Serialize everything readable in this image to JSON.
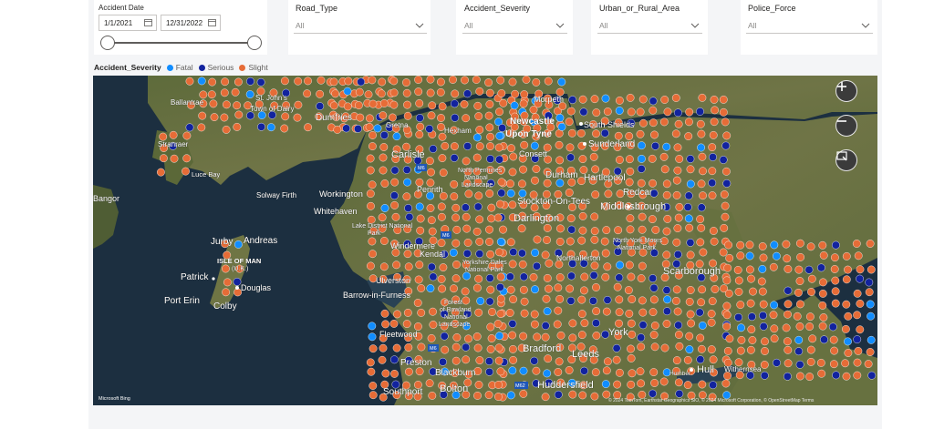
{
  "slicers": {
    "date": {
      "title": "Accident Date",
      "start": "1/1/2021",
      "end": "12/31/2022"
    },
    "dropdowns": [
      {
        "title": "Road_Type",
        "value": "All"
      },
      {
        "title": "Accident_Severity",
        "value": "All"
      },
      {
        "title": "Urban_or_Rural_Area",
        "value": "All"
      },
      {
        "title": "Police_Force",
        "value": "All"
      }
    ]
  },
  "legend": {
    "title": "Accident_Severity",
    "items": [
      {
        "label": "Fatal",
        "color": "#118dff"
      },
      {
        "label": "Serious",
        "color": "#12239e"
      },
      {
        "label": "Slight",
        "color": "#e66c37"
      }
    ]
  },
  "map": {
    "labels": {
      "ballantrae": "Ballantrae",
      "st_johns": "St. John's",
      "town_of_dalry": "Town of Dalry",
      "dumfries": "Dumfries",
      "gretna": "Gretna",
      "newcastle": "Newcastle",
      "upon_tyne": "Upon Tyne",
      "morpeth": "Morpeth",
      "south_shields": "South Shields",
      "sunderland": "Sunderland",
      "stranraer": "Stranraer",
      "carlisle": "Carlisle",
      "hexham": "Hexham",
      "consett": "Consett",
      "luce_bay": "Luce Bay",
      "north_pennines": "North Pennines",
      "national": "National",
      "landscape": "Landscape",
      "durham": "Durham",
      "hartlepool": "Hartlepool",
      "redcar": "Redcar",
      "bangor": "Bangor",
      "solway_firth": "Solway Firth",
      "workington": "Workington",
      "penrith": "Penrith",
      "stockton": "Stockton-On-Tees",
      "middlesbrough": "Middlesbrough",
      "whitehaven": "Whitehaven",
      "darlington": "Darlington",
      "lake_district": "Lake District National",
      "park": "Park",
      "jurby": "Jurby",
      "andreas": "Andreas",
      "windermere": "Windermere",
      "kendal": "Kendal",
      "north_york_moors": "North York Moors",
      "national_park": "National Park",
      "isle_of_man": "ISLE OF MAN",
      "uk": "(U.K.)",
      "yorkshire_dales": "Yorkshire Dales",
      "yorkshire_np": "National Park",
      "northallerton": "Northallerton",
      "scarborough": "Scarborough",
      "patrick": "Patrick",
      "ulverston": "Ulverston",
      "douglas": "Douglas",
      "barrow": "Barrow-in-Furness",
      "port_erin": "Port Erin",
      "colby": "Colby",
      "forest": "Forest",
      "of_bowland": "of Bowland",
      "bowland_national": "National",
      "bowland_landscape": "Landscape",
      "fleetwood": "Fleetwood",
      "york": "York",
      "bradford": "Bradford",
      "leeds": "Leeds",
      "preston": "Preston",
      "blackburn": "Blackburn",
      "hull": "Hull",
      "withernsea": "Withernsea",
      "southport": "Southport",
      "bolton": "Bolton",
      "huddersfield": "Huddersfield",
      "humber": "Humber",
      "m6": "M6",
      "m62": "M62"
    },
    "attribution": "© 2024 TomTom, Earthstar Geographics SIO, © 2024 Microsoft Corporation, © OpenStreetMap  Terms",
    "brand": "Microsoft Bing",
    "controls": [
      "zoom-in",
      "zoom-out",
      "select"
    ]
  }
}
